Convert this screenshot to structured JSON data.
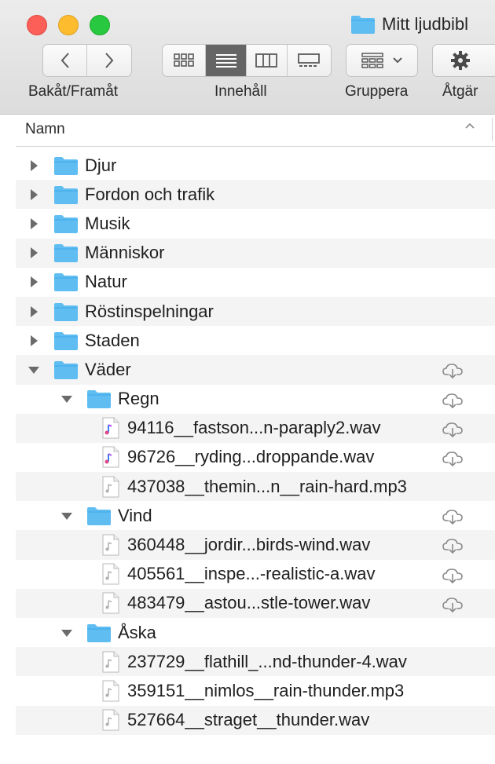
{
  "window": {
    "title": "Mitt ljudbibl",
    "folder_icon": "folder-icon"
  },
  "toolbar": {
    "back_forward_label": "Bakåt/Framåt",
    "view_label": "Innehåll",
    "group_label": "Gruppera",
    "action_label": "Åtgär",
    "selected_view": "list"
  },
  "column_header": {
    "name_label": "Namn",
    "sort_direction": "ascending"
  },
  "colors": {
    "folder": "#5fbdf2",
    "selected_view_bg": "#656565",
    "stripe": "#f4f4f5",
    "cloud": "#8a8a8a"
  },
  "items": [
    {
      "label": "Djur",
      "kind": "folder",
      "level": 0,
      "expanded": false,
      "cloud": false
    },
    {
      "label": "Fordon och trafik",
      "kind": "folder",
      "level": 0,
      "expanded": false,
      "cloud": false
    },
    {
      "label": "Musik",
      "kind": "folder",
      "level": 0,
      "expanded": false,
      "cloud": false
    },
    {
      "label": "Människor",
      "kind": "folder",
      "level": 0,
      "expanded": false,
      "cloud": false
    },
    {
      "label": "Natur",
      "kind": "folder",
      "level": 0,
      "expanded": false,
      "cloud": false
    },
    {
      "label": "Röstinspelningar",
      "kind": "folder",
      "level": 0,
      "expanded": false,
      "cloud": false
    },
    {
      "label": "Staden",
      "kind": "folder",
      "level": 0,
      "expanded": false,
      "cloud": false
    },
    {
      "label": "Väder",
      "kind": "folder",
      "level": 0,
      "expanded": true,
      "cloud": true
    },
    {
      "label": "Regn",
      "kind": "folder",
      "level": 1,
      "expanded": true,
      "cloud": true
    },
    {
      "label": "94116__fastson...n-paraply2.wav",
      "kind": "audio-color",
      "level": 2,
      "cloud": true
    },
    {
      "label": "96726__ryding...droppande.wav",
      "kind": "audio-color",
      "level": 2,
      "cloud": true
    },
    {
      "label": "437038__themin...n__rain-hard.mp3",
      "kind": "audio",
      "level": 2,
      "cloud": false
    },
    {
      "label": "Vind",
      "kind": "folder",
      "level": 1,
      "expanded": true,
      "cloud": true
    },
    {
      "label": "360448__jordir...birds-wind.wav",
      "kind": "audio",
      "level": 2,
      "cloud": true
    },
    {
      "label": "405561__inspe...-realistic-a.wav",
      "kind": "audio",
      "level": 2,
      "cloud": true
    },
    {
      "label": "483479__astou...stle-tower.wav",
      "kind": "audio",
      "level": 2,
      "cloud": true
    },
    {
      "label": "Åska",
      "kind": "folder",
      "level": 1,
      "expanded": true,
      "cloud": false
    },
    {
      "label": "237729__flathill_...nd-thunder-4.wav",
      "kind": "audio",
      "level": 2,
      "cloud": false
    },
    {
      "label": "359151__nimlos__rain-thunder.mp3",
      "kind": "audio",
      "level": 2,
      "cloud": false
    },
    {
      "label": "527664__straget__thunder.wav",
      "kind": "audio",
      "level": 2,
      "cloud": false
    }
  ]
}
